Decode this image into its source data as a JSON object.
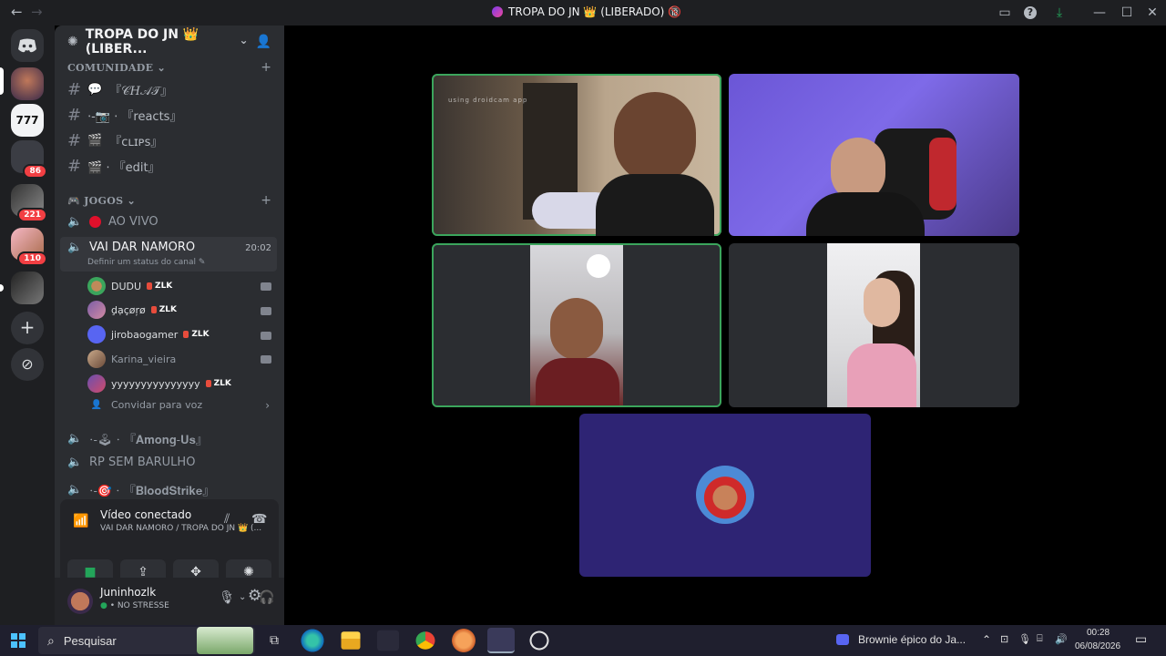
{
  "titlebar": {
    "title": "TROPA DO JN 👑 (LIBERADO) 🔞",
    "back": "←",
    "forward": "→"
  },
  "guild": {
    "name": "TROPA DO JN 👑 (LIBER...",
    "chevron": "⌄"
  },
  "servers": {
    "badges": [
      "86",
      "221",
      "110"
    ]
  },
  "categories": {
    "comunidade": "COMUNIDADE",
    "jogos": "JOGOS"
  },
  "channels": {
    "chat": "『𝒞𝐻𝒜𝒯』",
    "reacts": "⋅-📷 ⋅ 『reacts』",
    "clips": "『ᴄʟɪᴘs』",
    "edit": "🎬 ⋅ 『edit』",
    "ao_vivo": "AO VIVO",
    "vai_dar_namoro": "VAI DAR NAMORO",
    "vai_time": "20:02",
    "status_hint": "Definir um status do canal ✎",
    "among_us": "⋅-🕹 ⋅ 『𝐀𝐦𝐨𝐧𝐠-𝐔𝐬』",
    "rp_sem_barulho": "RP SEM BARULHO",
    "bloodstrike": "⋅-🎯 ⋅ 『𝐁𝐥𝐨𝐨𝐝𝐒𝐭𝐫𝐢𝐤𝐞』"
  },
  "members": [
    {
      "name": "DUDU",
      "tag": "ZLK",
      "cam": true
    },
    {
      "name": "ḑạçøŗø",
      "tag": "ZLK",
      "cam": true
    },
    {
      "name": "jirobaogamer",
      "tag": "ZLK",
      "cam": true
    },
    {
      "name": "Karina_vieira",
      "tag": "",
      "cam": true
    },
    {
      "name": "yyyyyyyyyyyyyyy",
      "tag": "ZLK",
      "cam": false
    }
  ],
  "invite": "Convidar para voz",
  "voice": {
    "status": "Vídeo conectado",
    "location": "VAI DAR NAMORO / TROPA DO JN 👑 (..."
  },
  "user": {
    "name": "Juninhozlk",
    "status": "NO STRESSE"
  },
  "video": {
    "overlay_text": "using droidcam app"
  },
  "taskbar": {
    "search": "Pesquisar",
    "media": "Brownie épico do Ja...",
    "time": "00:28",
    "date": "06/08/2026"
  },
  "colors": {
    "accent": "#5865f2",
    "speaking": "#3ba55c",
    "notification": "#f23f43"
  }
}
